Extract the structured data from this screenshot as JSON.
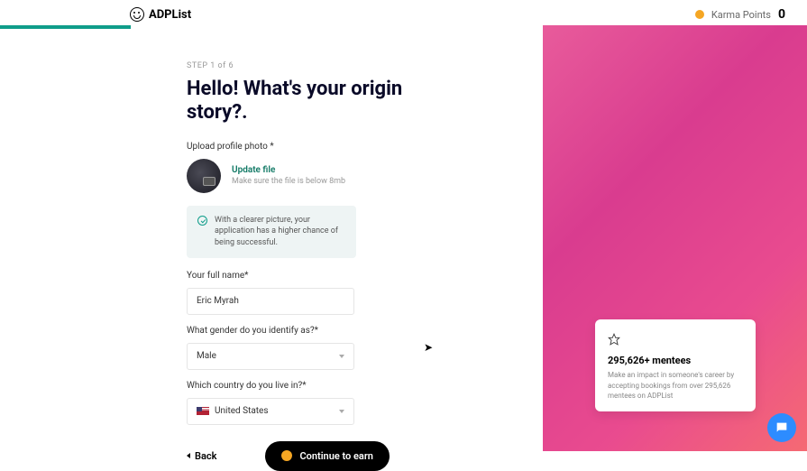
{
  "header": {
    "brand": "ADPList",
    "karma_label": "Karma Points",
    "karma_value": "0"
  },
  "form": {
    "step_label": "STEP 1 of 6",
    "heading": "Hello! What's your origin story?.",
    "upload": {
      "label": "Upload profile photo *",
      "action": "Update file",
      "hint": "Make sure the file is below 8mb"
    },
    "tip": "With a clearer picture, your application has a higher chance of being successful.",
    "name_label": "Your full name*",
    "name_value": "Eric Myrah",
    "gender_label": "What gender do you identify as?*",
    "gender_value": "Male",
    "country_label": "Which country do you live in?*",
    "country_value": "United States",
    "back": "Back",
    "continue": "Continue to earn"
  },
  "promo": {
    "count": "295,626+ mentees",
    "text": "Make an impact in someone's career by accepting bookings from over 295,626 mentees on ADPList"
  }
}
